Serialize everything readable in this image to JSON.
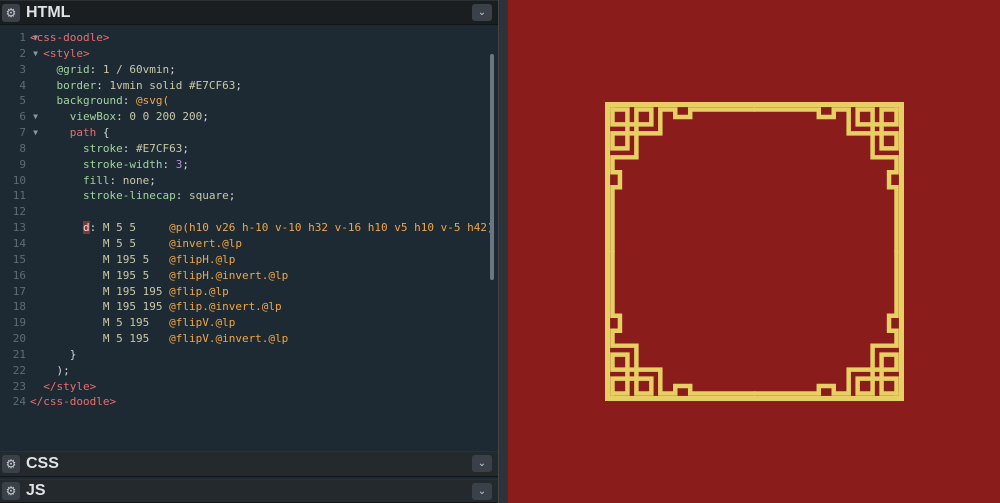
{
  "panels": {
    "html": {
      "title": "HTML"
    },
    "css": {
      "title": "CSS"
    },
    "js": {
      "title": "JS"
    }
  },
  "icons": {
    "gear": "⚙",
    "chevron": "⌄"
  },
  "colors": {
    "preview_background": "#8A1C1C",
    "doodle_stroke": "#E7CF63"
  },
  "code": {
    "line_numbers": [
      "1",
      "2",
      "3",
      "4",
      "5",
      "6",
      "7",
      "8",
      "9",
      "10",
      "11",
      "12",
      "13",
      "14",
      "15",
      "16",
      "17",
      "18",
      "19",
      "20",
      "21",
      "22",
      "23",
      "24"
    ],
    "fold_lines": [
      "1",
      "2",
      "6",
      "7"
    ],
    "lines": {
      "l1": {
        "t1": "<css-doodle>"
      },
      "l2": {
        "t1": "<style>"
      },
      "l3": {
        "p": "@grid",
        "c": ": ",
        "v": "1 / 60vmin",
        "e": ";"
      },
      "l4": {
        "p": "border",
        "c": ": ",
        "v": "1vmin solid #E7CF63",
        "e": ";"
      },
      "l5": {
        "p": "background",
        "c": ": ",
        "v": "@svg(",
        "e": ""
      },
      "l6": {
        "p": "viewBox",
        "c": ": ",
        "v": "0 0 200 200",
        "e": ";"
      },
      "l7": {
        "p": "path",
        "c": " {",
        "v": "",
        "e": ""
      },
      "l8": {
        "p": "stroke",
        "c": ": ",
        "v": "#E7CF63",
        "e": ";"
      },
      "l9": {
        "p": "stroke-width",
        "c": ": ",
        "v": "3",
        "e": ";"
      },
      "l10": {
        "p": "fill",
        "c": ": ",
        "v": "none",
        "e": ";"
      },
      "l11": {
        "p": "stroke-linecap",
        "c": ": ",
        "v": "square",
        "e": ";"
      },
      "l13": {
        "p": "d",
        "c": ": ",
        "m": "M 5 5     ",
        "a": "@p(h10 v26 h-10 v-10 h32 v-16 h10 v5 h10 v-5 h42)"
      },
      "l14": {
        "m": "M 5 5     ",
        "a": "@invert.@lp"
      },
      "l15": {
        "m": "M 195 5   ",
        "a": "@flipH.@lp"
      },
      "l16": {
        "m": "M 195 5   ",
        "a": "@flipH.@invert.@lp"
      },
      "l17": {
        "m": "M 195 195 ",
        "a": "@flip.@lp"
      },
      "l18": {
        "m": "M 195 195 ",
        "a": "@flip.@invert.@lp"
      },
      "l19": {
        "m": "M 5 195   ",
        "a": "@flipV.@lp"
      },
      "l20": {
        "m": "M 5 195   ",
        "a": "@flipV.@invert.@lp"
      },
      "l21": {
        "c": "}"
      },
      "l22": {
        "c": ");"
      },
      "l23": {
        "t1": "</style>"
      },
      "l24": {
        "t1": "</css-doodle>"
      }
    }
  }
}
